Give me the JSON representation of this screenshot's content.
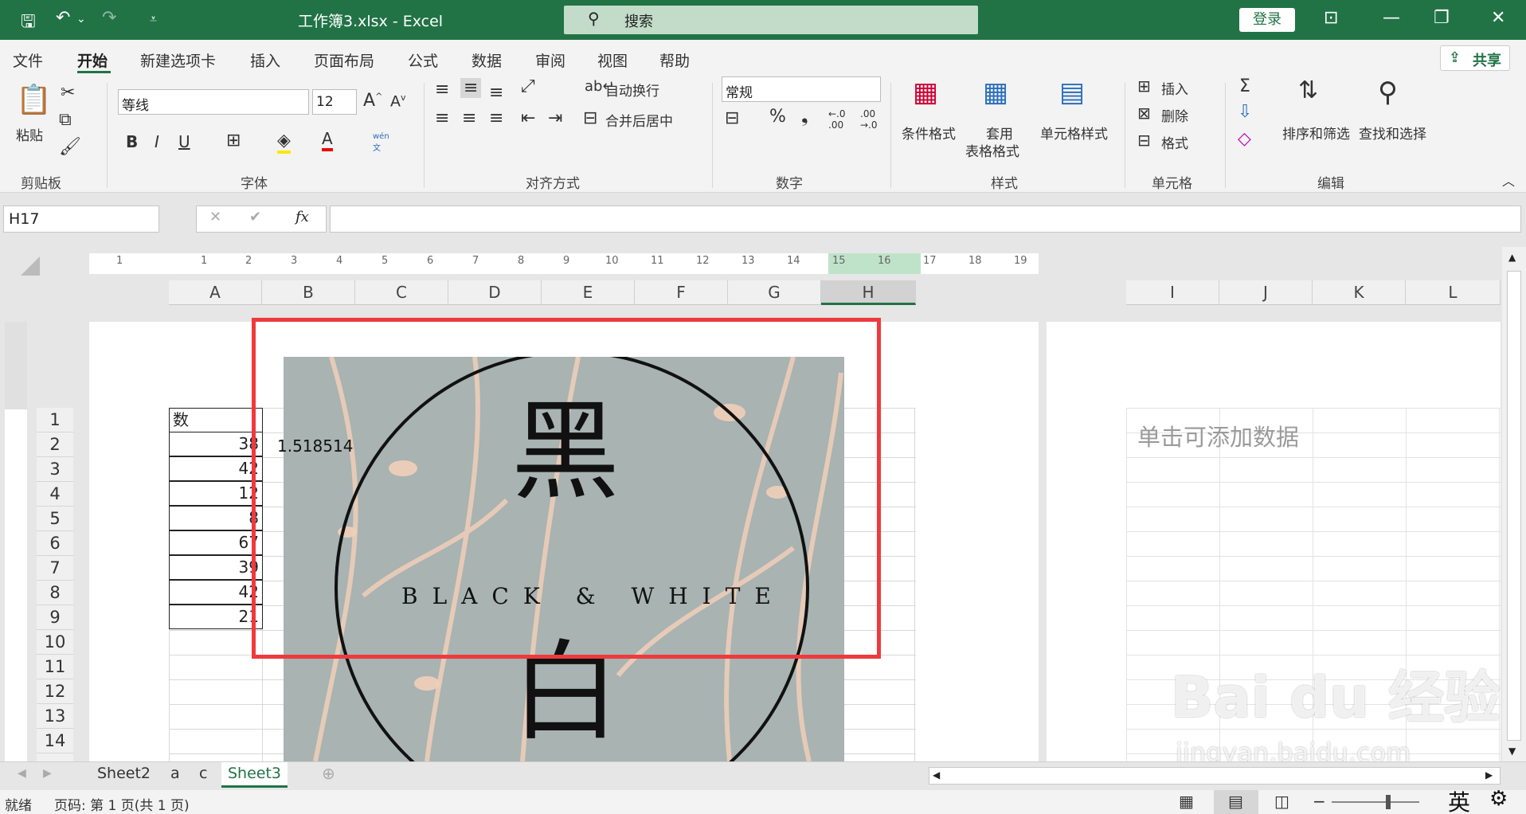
{
  "titlebar": {
    "doc_title": "工作簿3.xlsx  -  Excel",
    "search_placeholder": "搜索",
    "login": "登录"
  },
  "tabs": [
    "文件",
    "开始",
    "新建选项卡",
    "插入",
    "页面布局",
    "公式",
    "数据",
    "审阅",
    "视图",
    "帮助"
  ],
  "share": "共享",
  "ribbon": {
    "clipboard": {
      "paste": "粘贴",
      "label": "剪贴板"
    },
    "font": {
      "name": "等线",
      "size": "12",
      "label": "字体",
      "phonetic": "wén\n文"
    },
    "align": {
      "wrap": "自动换行",
      "merge": "合并后居中",
      "label": "对齐方式"
    },
    "number": {
      "format": "常规",
      "label": "数字",
      "percent": "%"
    },
    "styles": {
      "cond": "条件格式",
      "table1": "套用",
      "table2": "表格格式",
      "cell": "单元格样式",
      "label": "样式"
    },
    "cells": {
      "insert": "插入",
      "delete": "删除",
      "format": "格式",
      "label": "单元格"
    },
    "edit": {
      "sort": "排序和筛选",
      "find": "查找和选择",
      "label": "编辑"
    }
  },
  "namebox": "H17",
  "fx": "fx",
  "columns": [
    "A",
    "B",
    "C",
    "D",
    "E",
    "F",
    "G",
    "H"
  ],
  "columns2": [
    "I",
    "J",
    "K",
    "L"
  ],
  "ruler": [
    "1",
    "1",
    "2",
    "3",
    "4",
    "5",
    "6",
    "7",
    "8",
    "9",
    "10",
    "11",
    "12",
    "13",
    "14",
    "15",
    "16",
    "17",
    "18",
    "19"
  ],
  "rows": [
    "1",
    "2",
    "3",
    "4",
    "5",
    "6",
    "7",
    "8",
    "9",
    "10",
    "11",
    "12",
    "13",
    "14"
  ],
  "cells": {
    "header": "数",
    "values": [
      "38",
      "42",
      "12",
      "8",
      "67",
      "39",
      "42",
      "21"
    ],
    "b2": "1.518514"
  },
  "placeholder_right": "单击可添加数据",
  "image_text": {
    "top": "黑",
    "middle": "BLACK & WHITE",
    "bottom": "白"
  },
  "sheet_tabs": [
    "Sheet2",
    "a",
    "c",
    "Sheet3"
  ],
  "active_sheet": "Sheet3",
  "status": {
    "ready": "就绪",
    "page": "页码: 第 1 页(共 1 页)",
    "ime": "英"
  },
  "watermark": {
    "logo": "Bai du 经验",
    "url": "jingyan.baidu.com"
  },
  "colors": {
    "excel_green": "#217346",
    "red_box": "#ee3a3e"
  }
}
